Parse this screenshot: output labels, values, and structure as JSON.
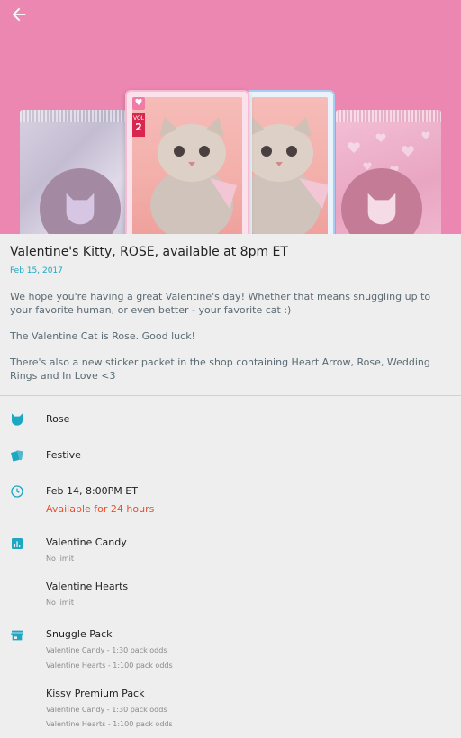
{
  "header": {
    "back_icon": "arrow-left-icon"
  },
  "hero": {
    "background_color": "#ec87b1",
    "card_volume_label": "VOL",
    "card_volume_number": "2"
  },
  "post": {
    "title": "Valentine's Kitty, ROSE, available at 8pm ET",
    "date": "Feb 15, 2017",
    "paragraphs": [
      "We hope you're having a great Valentine's day! Whether that means snuggling up to your favorite human, or even better - your favorite cat :)",
      "The Valentine Cat is Rose. Good luck!",
      "There's also a new sticker packet in the shop containing Heart Arrow, Rose, Wedding Rings and In Love <3"
    ]
  },
  "details": {
    "accent_color": "#1ca7c2",
    "cat": {
      "icon": "cat-face-icon",
      "label": "Rose"
    },
    "theme": {
      "icon": "cards-icon",
      "label": "Festive"
    },
    "time": {
      "icon": "clock-icon",
      "label": "Feb 14, 8:00PM ET",
      "availability": "Available for 24 hours"
    },
    "limits": {
      "icon": "bar-chart-icon",
      "items": [
        {
          "name": "Valentine Candy",
          "limit": "No limit"
        },
        {
          "name": "Valentine Hearts",
          "limit": "No limit"
        }
      ]
    },
    "packs": {
      "icon": "store-icon",
      "items": [
        {
          "name": "Snuggle Pack",
          "odds": [
            "Valentine Candy - 1:30 pack odds",
            "Valentine Hearts - 1:100 pack odds"
          ]
        },
        {
          "name": "Kissy Premium Pack",
          "odds": [
            "Valentine Candy - 1:30 pack odds",
            "Valentine Hearts - 1:100 pack odds"
          ]
        }
      ]
    }
  }
}
